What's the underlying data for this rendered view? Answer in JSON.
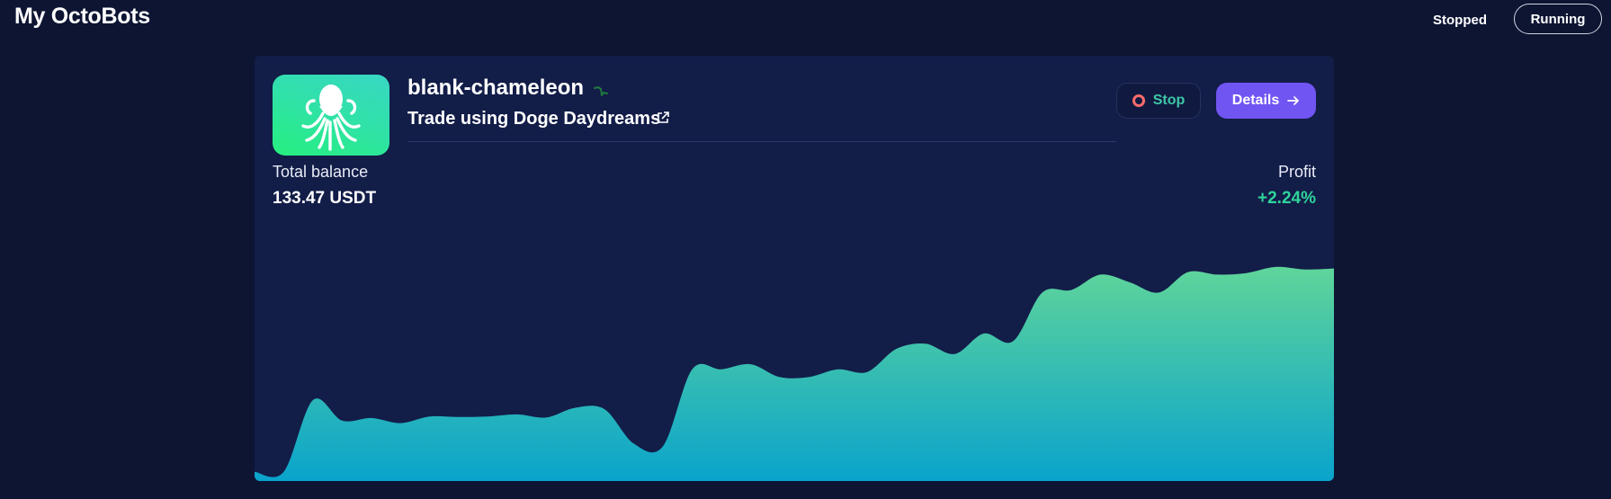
{
  "header": {
    "title": "My OctoBots",
    "filters": {
      "stopped_label": "Stopped",
      "running_label": "Running"
    }
  },
  "bot": {
    "name": "blank-chameleon",
    "strategy": "Trade using Doge Daydreams",
    "icons": {
      "avatar": "octopus-icon",
      "trend": "sparkline-icon",
      "strategy_link": "external-link-icon",
      "stop": "stop-circle-icon",
      "details": "arrow-right-icon"
    },
    "actions": {
      "stop_label": "Stop",
      "details_label": "Details"
    },
    "total_balance_label": "Total balance",
    "total_balance_value": "133.47 USDT",
    "profit_label": "Profit",
    "profit_value": "+2.24%"
  },
  "colors": {
    "background": "#0d1533",
    "card": "#121d48",
    "accent": "#7155f3",
    "profit_positive": "#2fd49b",
    "stop_text": "#3ec7a6",
    "stop_icon": "#ff6b6b",
    "chart_top": "#5fd59a",
    "chart_bottom": "#0aa3cc"
  },
  "chart_data": {
    "type": "area",
    "title": "",
    "xlabel": "",
    "ylabel": "",
    "grid": false,
    "values": [
      0.0,
      0.0,
      1.4,
      1.0,
      1.05,
      0.95,
      1.08,
      1.07,
      1.08,
      1.12,
      1.06,
      1.25,
      1.22,
      0.55,
      0.5,
      2.0,
      2.0,
      2.1,
      1.85,
      1.85,
      2.0,
      1.95,
      2.4,
      2.5,
      2.3,
      2.7,
      2.55,
      3.5,
      3.55,
      3.85,
      3.7,
      3.5,
      3.9,
      3.85,
      3.88,
      4.0,
      3.95,
      3.97
    ],
    "ylim": [
      -0.18,
      4.7
    ]
  }
}
